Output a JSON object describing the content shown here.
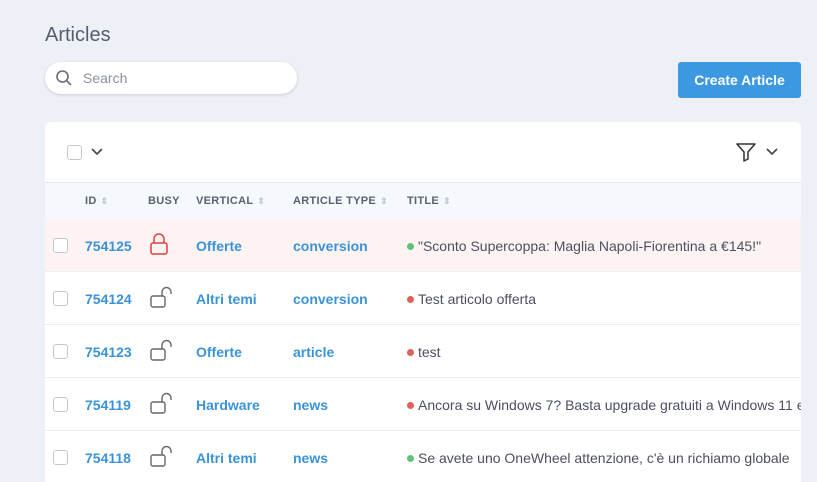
{
  "page": {
    "title": "Articles"
  },
  "search": {
    "placeholder": "Search"
  },
  "toolbar": {
    "create_label": "Create Article"
  },
  "table": {
    "headers": [
      "ID",
      "BUSY",
      "VERTICAL",
      "ARTICLE TYPE",
      "TITLE"
    ],
    "rows": [
      {
        "id": "754125",
        "busy": true,
        "vertical": "Offerte",
        "type": "conversion",
        "status": "green",
        "title": "\"Sconto Supercoppa: Maglia Napoli-Fiorentina a €145!\""
      },
      {
        "id": "754124",
        "busy": false,
        "vertical": "Altri temi",
        "type": "conversion",
        "status": "red",
        "title": "Test articolo offerta"
      },
      {
        "id": "754123",
        "busy": false,
        "vertical": "Offerte",
        "type": "article",
        "status": "red",
        "title": "test"
      },
      {
        "id": "754119",
        "busy": false,
        "vertical": "Hardware",
        "type": "news",
        "status": "red",
        "title": "Ancora su Windows 7? Basta upgrade gratuiti a Windows 11 e"
      },
      {
        "id": "754118",
        "busy": false,
        "vertical": "Altri temi",
        "type": "news",
        "status": "green",
        "title": "Se avete uno OneWheel attenzione, c'è un richiamo globale"
      }
    ]
  },
  "colors": {
    "green": "#5fc277",
    "red": "#e0605a",
    "accent": "#3d98e2"
  }
}
